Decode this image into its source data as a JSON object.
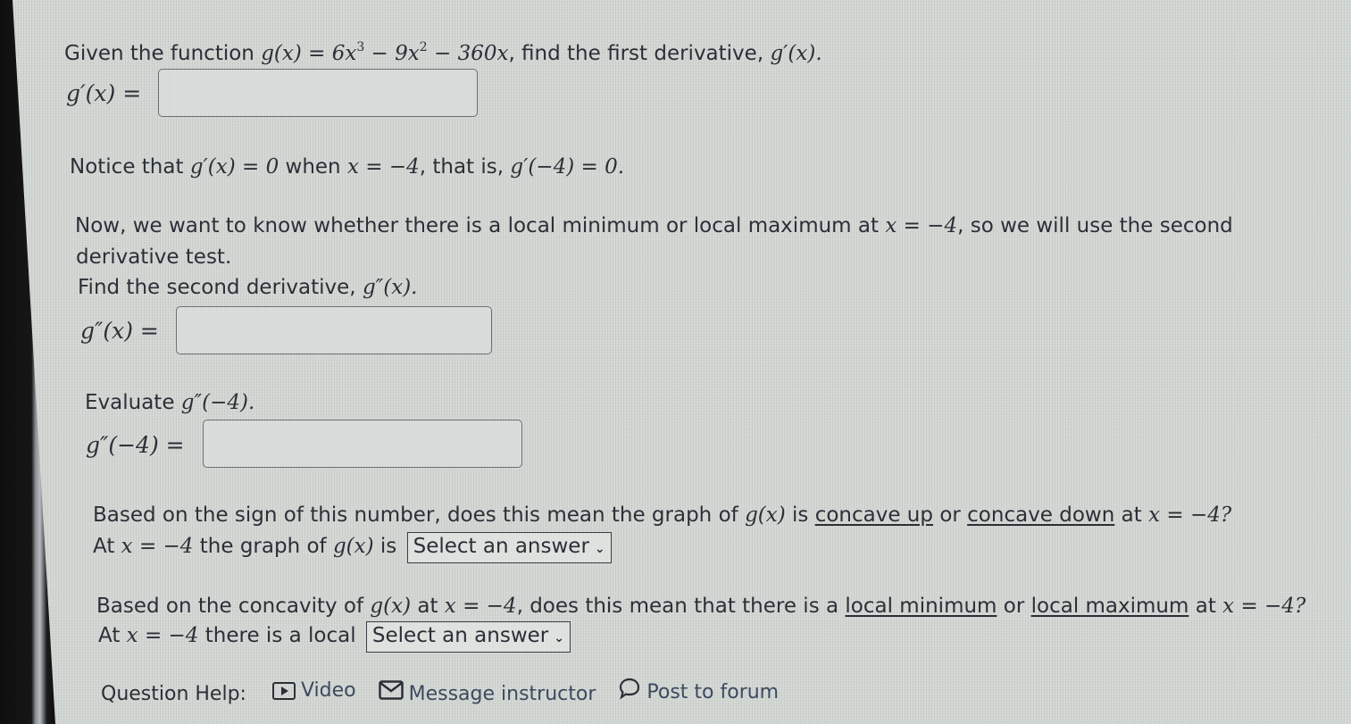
{
  "q1": {
    "intro": "Given the function",
    "function_lhs": "g(x) = 6x",
    "exp1": "3",
    "mid1": " − 9x",
    "exp2": "2",
    "mid2": " − 360x",
    "tail": ", find the first derivative,",
    "target": "g′(x).",
    "answer_label": "g′(x) =",
    "answer_value": ""
  },
  "notice": {
    "prefix": "Notice that",
    "expr1": "g′(x) = 0",
    "when": "when",
    "expr2": "x = −4",
    "thatis": ", that is,",
    "expr3": "g′(−4) = 0."
  },
  "now": {
    "line1_prefix": "Now, we want to know whether there is a local minimum or local maximum at",
    "line1_expr": "x = −4",
    "line1_suffix": ", so we will use the second",
    "line2": "derivative test.",
    "find_prefix": "Find the second derivative,",
    "find_expr": "g″(x)."
  },
  "q2": {
    "answer_label": "g″(x) =",
    "answer_value": ""
  },
  "q3": {
    "prompt_prefix": "Evaluate",
    "prompt_expr": "g″(−4).",
    "answer_label": "g″(−4) =",
    "answer_value": ""
  },
  "q4": {
    "p1": "Based on the sign of this number, does this mean the graph of",
    "p_expr": "g(x)",
    "p2": "is",
    "opt_a": "concave up",
    "or": "or",
    "opt_b": "concave down",
    "at": "at",
    "at_expr": "x = −4?",
    "a_prefix": "At",
    "a_expr": "x = −4",
    "a_mid": "the graph of",
    "a_expr2": "g(x)",
    "a_is": "is",
    "select_label": "Select an answer"
  },
  "q5": {
    "p1": "Based on the concavity of",
    "p_expr": "g(x)",
    "p_at": "at",
    "p_expr2": "x = −4",
    "p2": ", does this mean that there is a",
    "opt_a": "local minimum",
    "or": "or",
    "opt_b": "local maximum",
    "at": "at",
    "at_expr": "x = −4?",
    "a_prefix": "At",
    "a_expr": "x = −4",
    "a_mid": "there is a local",
    "select_label": "Select an answer"
  },
  "help": {
    "label": "Question Help:",
    "video": "Video",
    "message": "Message instructor",
    "forum": "Post to forum"
  }
}
